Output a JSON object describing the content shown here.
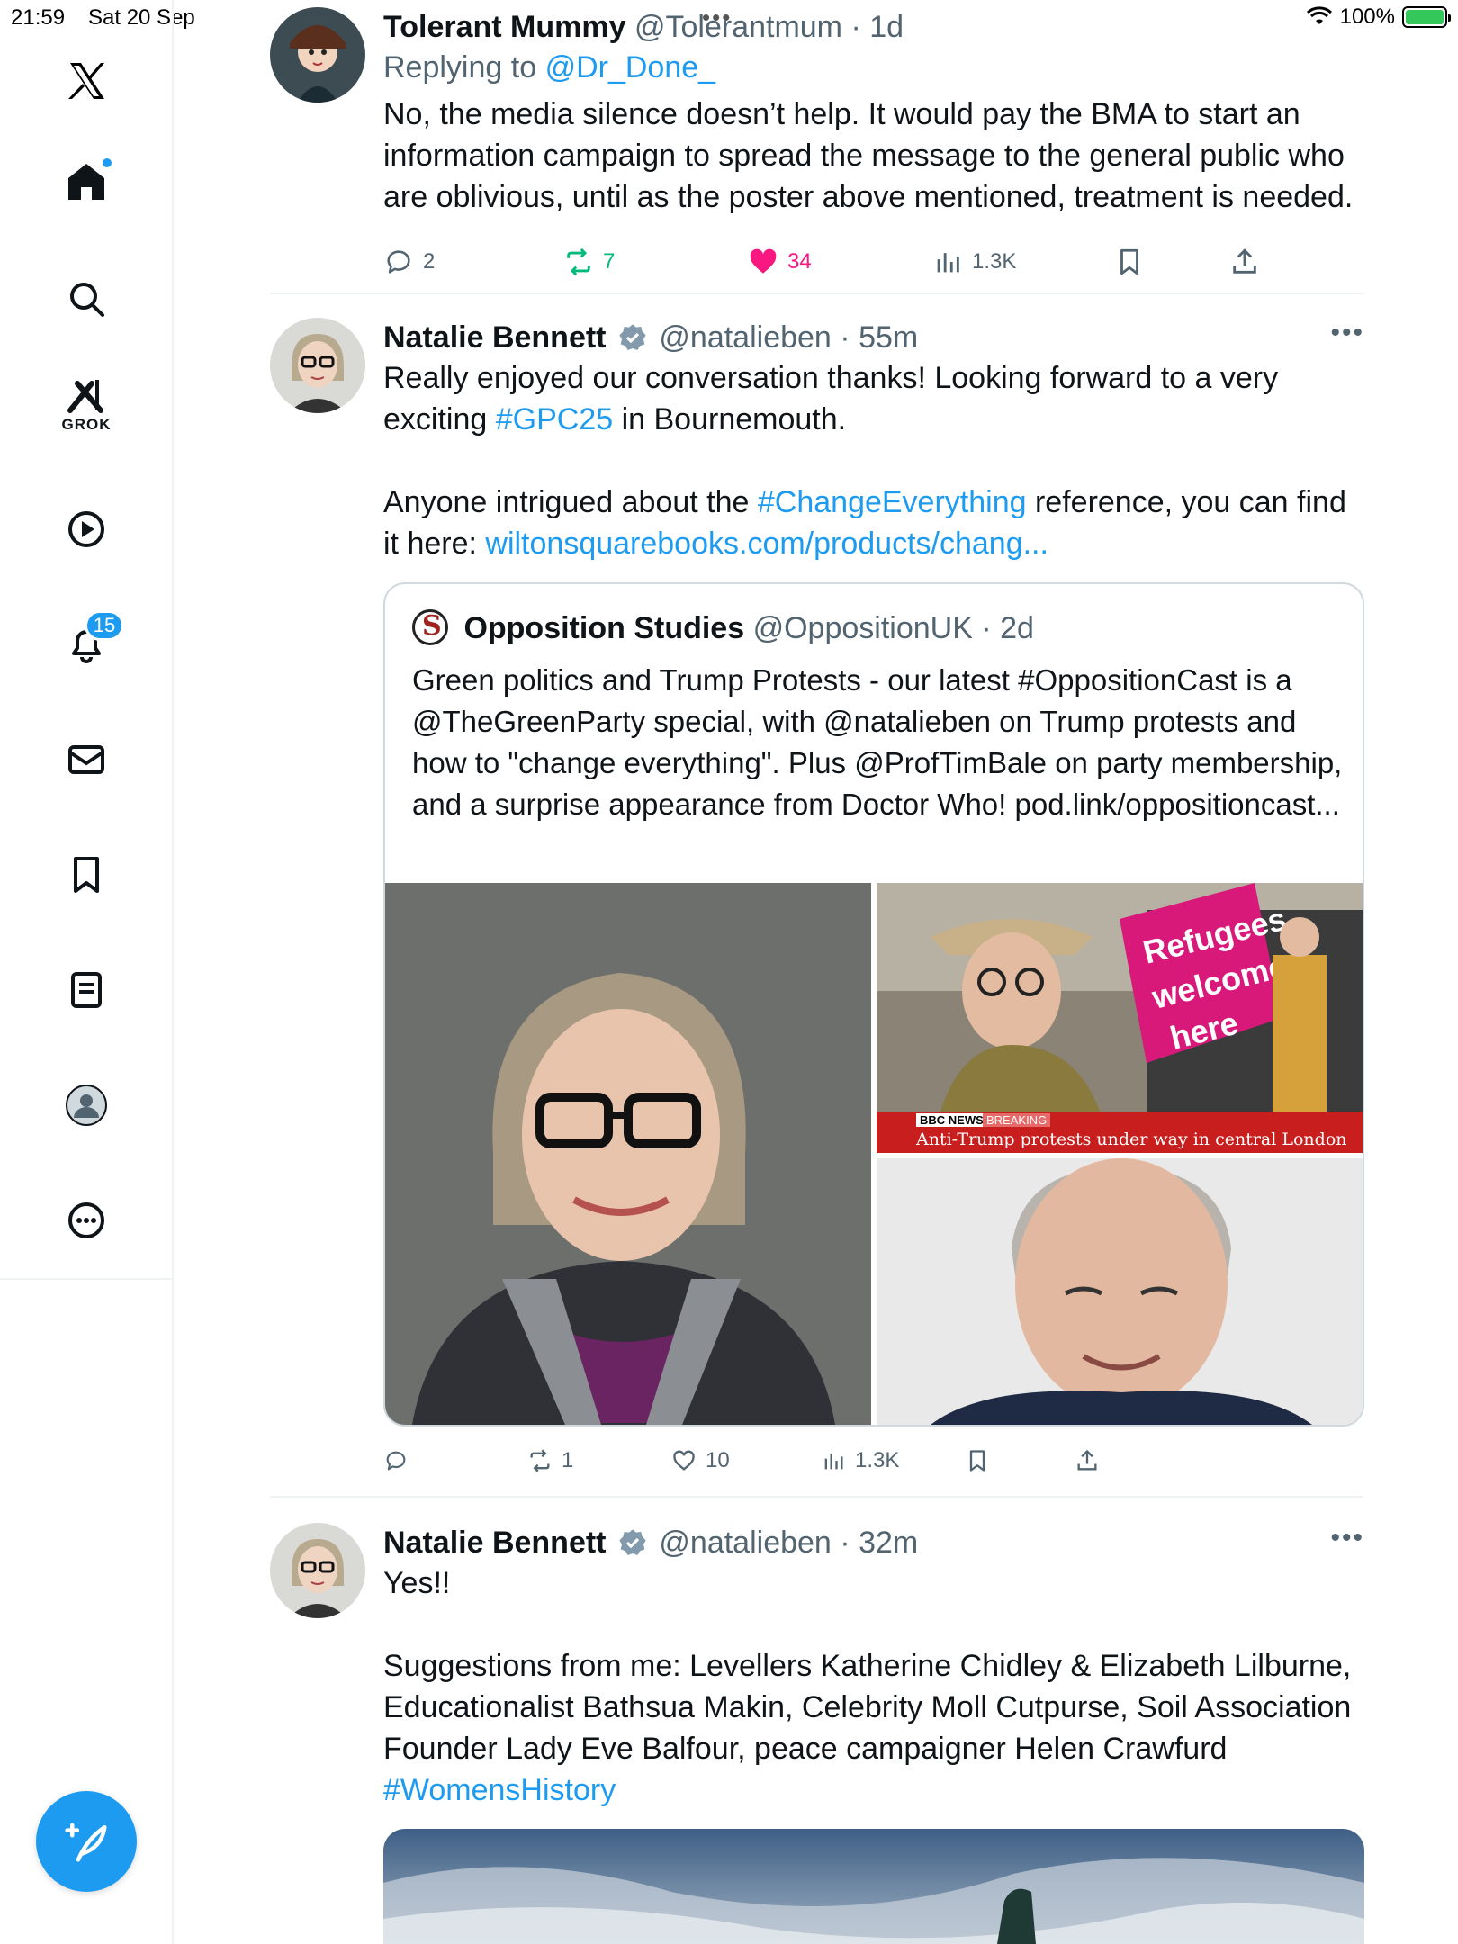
{
  "status_bar": {
    "time": "21:59",
    "date": "Sat 20 Sep",
    "battery": "100%"
  },
  "sidebar": {
    "notifications_badge": "15",
    "grok_label": "GROK",
    "accent": "#1d9bf0"
  },
  "tweets": [
    {
      "name": "Tolerant Mummy",
      "handle": "@Tolerantmum",
      "time": "· 1d",
      "replying_prefix": "Replying to",
      "replying_to": "@Dr_Done_",
      "text": "No, the media silence doesn’t help. It would pay the BMA to start an information campaign to spread the message to the general public who are oblivious, until as the poster above mentioned, treatment is needed.",
      "replies": "2",
      "reposts": "7",
      "likes": "34",
      "views": "1.3K"
    },
    {
      "name": "Natalie Bennett",
      "handle": "@natalieben",
      "time": "· 55m",
      "text_a": "Really enjoyed our conversation thanks! Looking forward to a very exciting ",
      "hashtag_a": "#GPC25",
      "text_b": " in Bournemouth.",
      "text_c": "Anyone intrigued about the ",
      "hashtag_b": "#ChangeEverything",
      "text_d": " reference, you can find it here: ",
      "link": "wiltonsquarebooks.com/products/chang...",
      "quote": {
        "name": "Opposition Studies",
        "handle": "@OppositionUK",
        "time": "· 2d",
        "text": "Green politics and Trump Protests - our latest #OppositionCast is a @TheGreenParty special, with  @natalieben on Trump protests and how to \"change everything\". Plus @ProfTimBale on party membership, and a surprise appearance from Doctor Who! pod.link/oppositioncast...",
        "news_tag": "BBC NEWS",
        "news_tag2": "BREAKING",
        "news_headline": "Anti-Trump protests under way in central London",
        "sign_text": "Say it loud Say it clear: Refugees welcome here"
      },
      "replies": "",
      "reposts": "1",
      "likes": "10",
      "views": "1.3K"
    },
    {
      "name": "Natalie Bennett",
      "handle": "@natalieben",
      "time": "· 32m",
      "text_a": "Yes!!",
      "text_b": "Suggestions from me: Levellers Katherine Chidley & Elizabeth Lilburne, Educationalist Bathsua Makin, Celebrity Moll Cutpurse, Soil Association Founder Lady Eve Balfour, peace campaigner Helen Crawfurd",
      "hashtag": "#WomensHistory"
    }
  ]
}
